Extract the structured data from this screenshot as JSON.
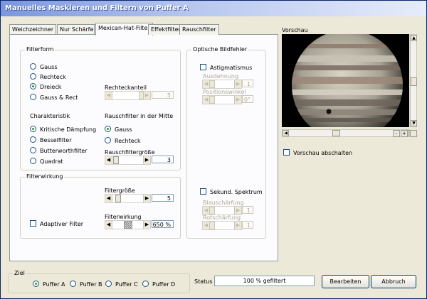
{
  "window": {
    "title": "Manuelles Maskieren und Filtern von Puffer A"
  },
  "tabs": [
    {
      "label": "Weichzeichner",
      "active": false
    },
    {
      "label": "Nur Schärfen",
      "active": false
    },
    {
      "label": "Mexican-Hat-Filter",
      "active": true
    },
    {
      "label": "Effektfilter",
      "active": false
    },
    {
      "label": "Rauschfilter",
      "active": false
    }
  ],
  "filterform": {
    "title": "Filterform",
    "options": [
      "Gauss",
      "Rechteck",
      "Dreieck",
      "Gauss & Rect"
    ],
    "selected": "Dreieck",
    "rechteckanteil_label": "Rechteckanteil",
    "rechteckanteil_value": "5",
    "charakteristik_label": "Charakteristik",
    "charakteristik_options": [
      "Kritische Dämpfung",
      "Besselfilter",
      "Butterworthfilter",
      "Quadrat"
    ],
    "charakteristik_selected": "Kritische Dämpfung",
    "rauschfilter_label": "Rauschfilter in der Mitte",
    "rauschfilter_options": [
      "Gauss",
      "Rechteck"
    ],
    "rauschfilter_selected": "Gauss",
    "rauschfiltergroesse_label": "Rauschfiltergröße",
    "rauschfiltergroesse_value": "3"
  },
  "optische": {
    "title": "Optische Bildfehler",
    "astigmatismus_label": "Astigmatismus",
    "astigmatismus_checked": false,
    "ausdehnung_label": "Ausdehnung",
    "ausdehnung_value": "1",
    "positionswinkel_label": "Positionswinkel",
    "positionswinkel_value": "0°",
    "sekund_label": "Sekund. Spektrum",
    "sekund_checked": false,
    "blauschaerfung_label": "Blauschärfung",
    "blauschaerfung_value": "1",
    "rotschaerfung_label": "Rotschärfung",
    "rotschaerfung_value": "1"
  },
  "filterwirkung": {
    "title": "Filterwirkung",
    "filtergroesse_label": "Filtergröße",
    "filtergroesse_value": "5",
    "adaptiv_label": "Adaptiver Filter",
    "adaptiv_checked": false,
    "wirkung_label": "Filterwirkung",
    "wirkung_value": "650 %"
  },
  "preview": {
    "title": "Vorschau",
    "disable_label": "Vorschau abschalten",
    "disable_checked": false
  },
  "ziel": {
    "title": "Ziel",
    "options": [
      "Puffer A",
      "Puffer B",
      "Puffer C",
      "Puffer D"
    ],
    "selected": "Puffer A"
  },
  "status": {
    "label": "Status",
    "value": "100 % gefiltert"
  },
  "buttons": {
    "edit": "Bearbeiten",
    "cancel": "Abbruch"
  }
}
